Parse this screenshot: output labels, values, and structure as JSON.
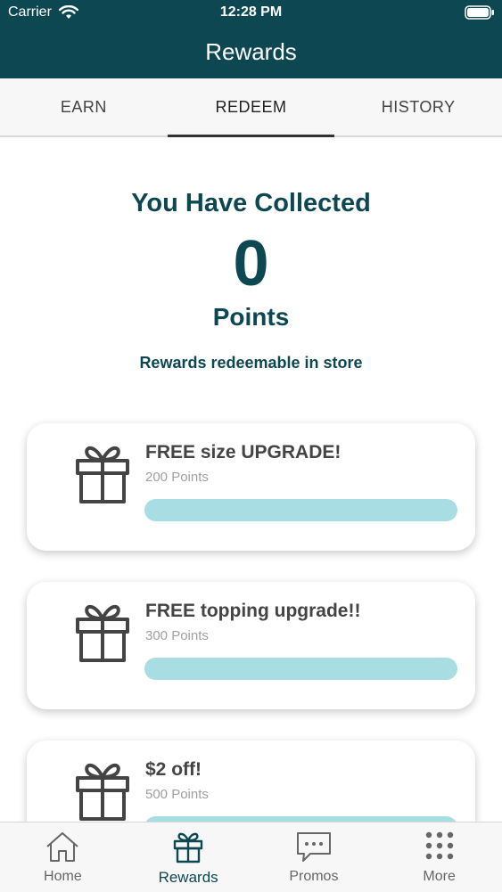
{
  "status_bar": {
    "carrier": "Carrier",
    "time": "12:28 PM",
    "wifi_icon": "wifi-icon",
    "battery_icon": "battery-icon"
  },
  "header": {
    "title": "Rewards"
  },
  "tabs": [
    {
      "label": "EARN",
      "active": false
    },
    {
      "label": "REDEEM",
      "active": true
    },
    {
      "label": "HISTORY",
      "active": false
    }
  ],
  "summary": {
    "title": "You Have Collected",
    "points": "0",
    "points_label": "Points",
    "note": "Rewards redeemable in store"
  },
  "rewards": [
    {
      "title": "FREE size UPGRADE!",
      "points": "200 Points",
      "progress": 0,
      "icon": "gift-icon"
    },
    {
      "title": "FREE topping upgrade!!",
      "points": "300 Points",
      "progress": 0,
      "icon": "gift-icon"
    },
    {
      "title": "$2 off!",
      "points": "500 Points",
      "progress": 0,
      "icon": "gift-icon"
    }
  ],
  "tabbar": [
    {
      "label": "Home",
      "icon": "home-icon",
      "active": false
    },
    {
      "label": "Rewards",
      "icon": "gift-icon",
      "active": true
    },
    {
      "label": "Promos",
      "icon": "chat-bubble-icon",
      "active": false
    },
    {
      "label": "More",
      "icon": "grid-dots-icon",
      "active": false
    }
  ],
  "colors": {
    "brand": "#0d4852",
    "progress_track": "#a7dde3",
    "text_dark": "#444444",
    "text_muted": "#a0a0a0"
  }
}
